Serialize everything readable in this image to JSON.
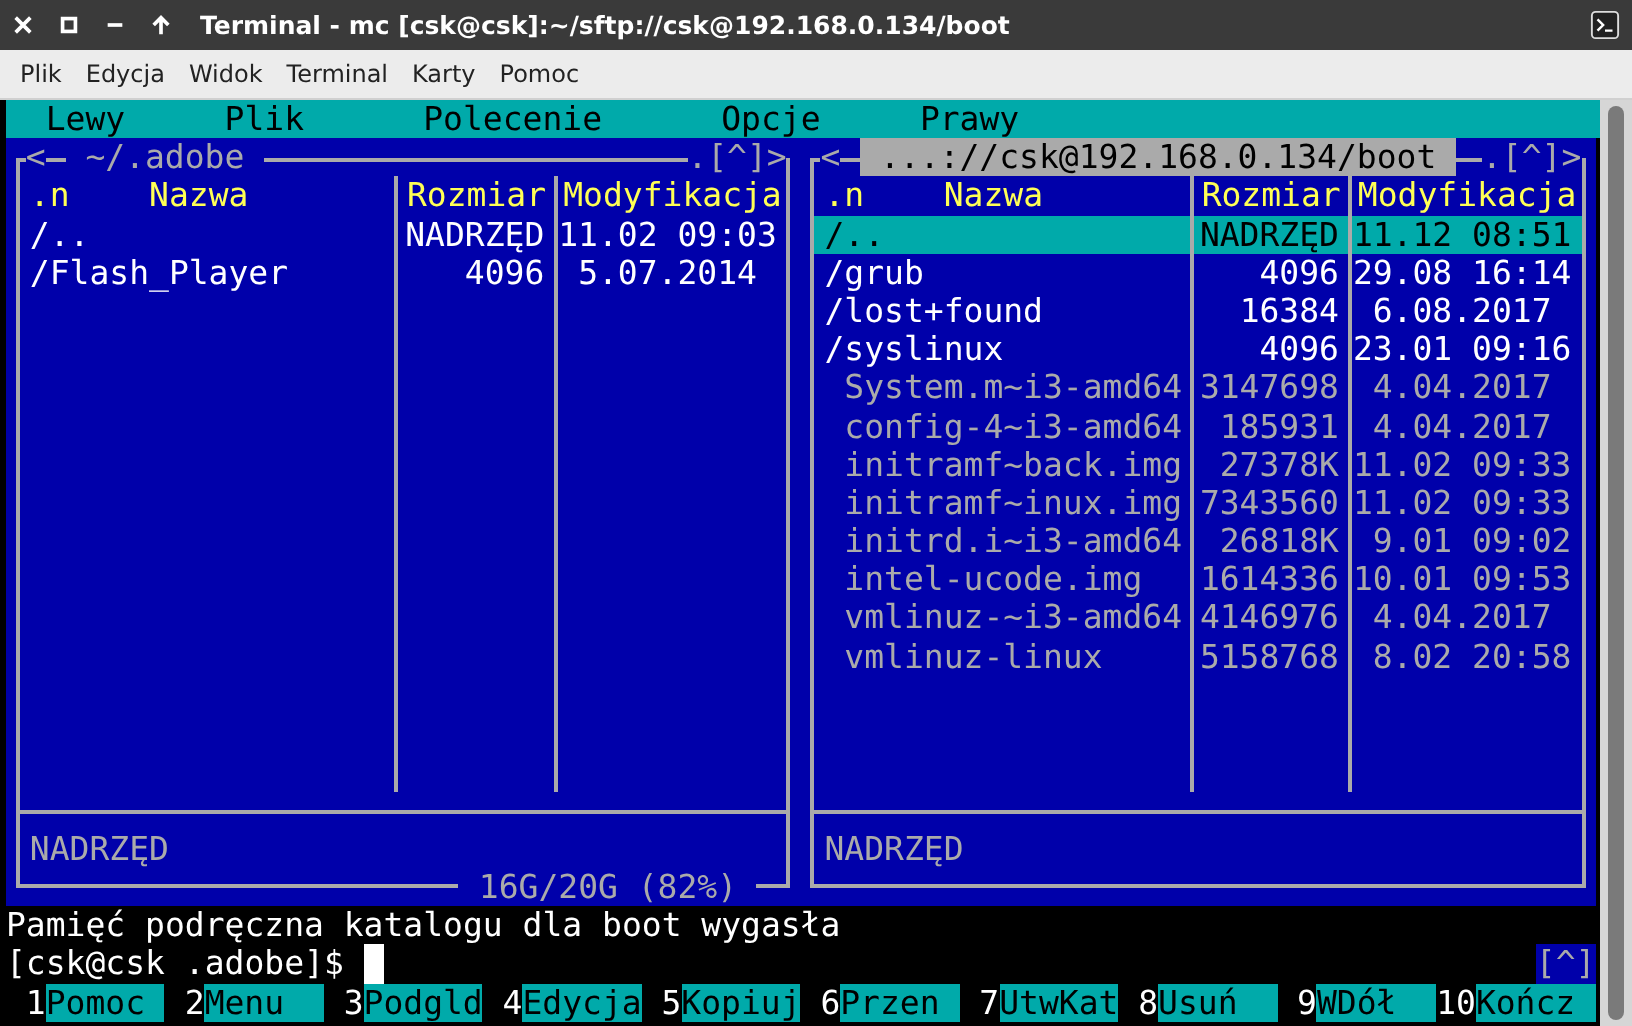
{
  "window": {
    "title": "Terminal - mc [csk@csk]:~/sftp://csk@192.168.0.134/boot"
  },
  "menu": [
    "Plik",
    "Edycja",
    "Widok",
    "Terminal",
    "Karty",
    "Pomoc"
  ],
  "mc_menu": [
    "Lewy",
    "Plik",
    "Polecenie",
    "Opcje",
    "Prawy"
  ],
  "panels": [
    {
      "active": false,
      "prev": "<",
      "title": "~/.adobe",
      "hotlist": ".[^]>",
      "headers": [
        ".n",
        "Nazwa",
        "Rozmiar",
        "Modyfikacja"
      ],
      "rows": [
        {
          "kind": "dir",
          "name": "/..",
          "size": "NADRZĘD",
          "modified": "11.02 09:03",
          "selected": false
        },
        {
          "kind": "dir",
          "name": "/Flash_Player",
          "size": "4096",
          "modified": "5.07.2014",
          "selected": false
        }
      ],
      "mini_status": "NADRZĘD",
      "disk_info": "16G/20G (82%)"
    },
    {
      "active": true,
      "prev": "<",
      "title": "...://csk@192.168.0.134/boot",
      "hotlist": ".[^]>",
      "headers": [
        ".n",
        "Nazwa",
        "Rozmiar",
        "Modyfikacja"
      ],
      "rows": [
        {
          "kind": "dir",
          "name": "/..",
          "size": "NADRZĘD",
          "modified": "11.12 08:51",
          "selected": true
        },
        {
          "kind": "dir",
          "name": "/grub",
          "size": "4096",
          "modified": "29.08 16:14",
          "selected": false
        },
        {
          "kind": "dir",
          "name": "/lost+found",
          "size": "16384",
          "modified": "6.08.2017",
          "selected": false
        },
        {
          "kind": "dir",
          "name": "/syslinux",
          "size": "4096",
          "modified": "23.01 09:16",
          "selected": false
        },
        {
          "kind": "file",
          "name": "System.m~i3-amd64",
          "size": "3147698",
          "modified": "4.04.2017",
          "selected": false
        },
        {
          "kind": "file",
          "name": "config-4~i3-amd64",
          "size": "185931",
          "modified": "4.04.2017",
          "selected": false
        },
        {
          "kind": "file",
          "name": "initramf~back.img",
          "size": "27378K",
          "modified": "11.02 09:33",
          "selected": false
        },
        {
          "kind": "file",
          "name": "initramf~inux.img",
          "size": "7343560",
          "modified": "11.02 09:33",
          "selected": false
        },
        {
          "kind": "file",
          "name": "initrd.i~i3-amd64",
          "size": "26818K",
          "modified": "9.01 09:02",
          "selected": false
        },
        {
          "kind": "file",
          "name": "intel-ucode.img",
          "size": "1614336",
          "modified": "10.01 09:53",
          "selected": false
        },
        {
          "kind": "file",
          "name": "vmlinuz-~i3-amd64",
          "size": "4146976",
          "modified": "4.04.2017",
          "selected": false
        },
        {
          "kind": "file",
          "name": "vmlinuz-linux",
          "size": "5158768",
          "modified": "8.02 20:58",
          "selected": false
        }
      ],
      "mini_status": "NADRZĘD"
    }
  ],
  "message": "Pamięć podręczna katalogu dla boot wygasła",
  "prompt": "[csk@csk .adobe]$",
  "history_button": "[^]",
  "keybar": [
    {
      "num": "1",
      "label": "Pomoc"
    },
    {
      "num": "2",
      "label": "Menu"
    },
    {
      "num": "3",
      "label": "Podgld"
    },
    {
      "num": "4",
      "label": "Edycja"
    },
    {
      "num": "5",
      "label": "Kopiuj"
    },
    {
      "num": "6",
      "label": "Przen"
    },
    {
      "num": "7",
      "label": "UtwKat"
    },
    {
      "num": "8",
      "label": "Usuń"
    },
    {
      "num": "9",
      "label": "WDół"
    },
    {
      "num": "10",
      "label": "Kończ"
    }
  ]
}
